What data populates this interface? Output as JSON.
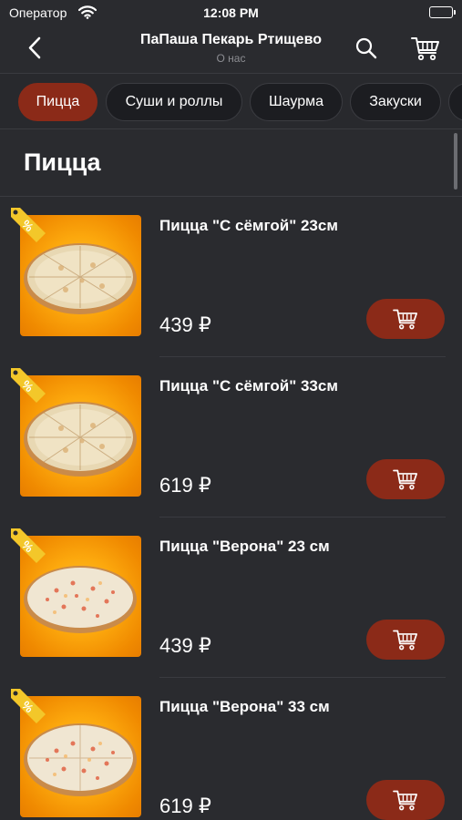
{
  "status_bar": {
    "carrier": "Оператор",
    "time": "12:08 PM"
  },
  "nav": {
    "title": "ПаПаша Пекарь Ртищево",
    "subtitle": "О нас"
  },
  "tabs": [
    {
      "label": "Пицца",
      "active": true
    },
    {
      "label": "Суши и роллы",
      "active": false
    },
    {
      "label": "Шаурма",
      "active": false
    },
    {
      "label": "Закуски",
      "active": false
    },
    {
      "label": "",
      "active": false
    }
  ],
  "section": {
    "title": "Пицца"
  },
  "items": [
    {
      "name": "Пицца \"С сёмгой\" 23см",
      "price": "439 ₽"
    },
    {
      "name": "Пицца \"С сёмгой\" 33см",
      "price": "619 ₽"
    },
    {
      "name": "Пицца \"Верона\" 23 см",
      "price": "439 ₽"
    },
    {
      "name": "Пицца \"Верона\" 33 см",
      "price": "619 ₽"
    }
  ],
  "icons": {
    "back": "chevron-left-icon",
    "search": "search-icon",
    "cart": "cart-icon",
    "discount": "discount-tag-icon",
    "wifi": "wifi-icon",
    "battery": "battery-icon"
  },
  "colors": {
    "background": "#2a2b2f",
    "accent": "#8b2a18",
    "tag": "#f3c72a",
    "image_bg": "#fca80d"
  }
}
